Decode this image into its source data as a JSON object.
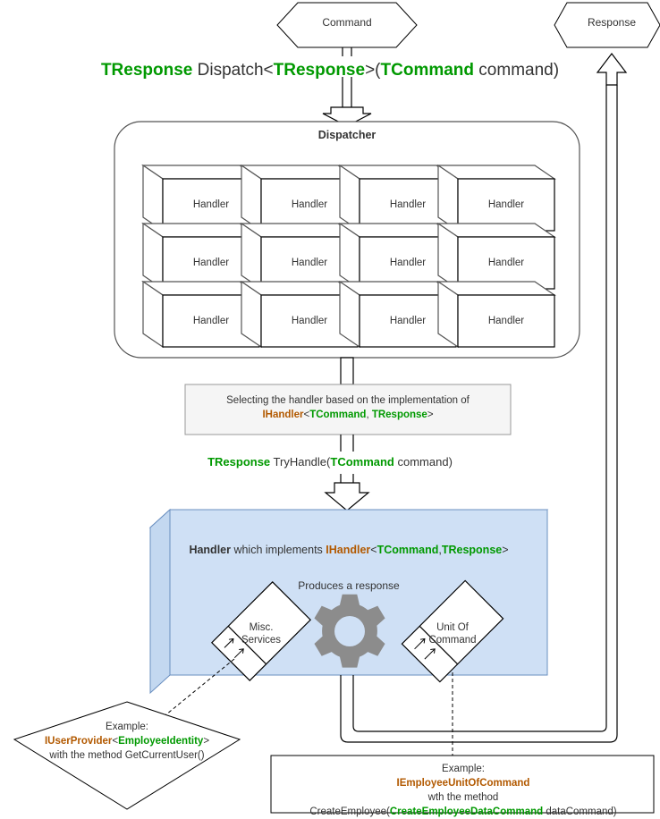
{
  "diagram": {
    "title": "CQRS Dispatcher / Handler flow",
    "colors": {
      "green": "#009900",
      "orange": "#b25900",
      "text": "#333333",
      "handler_box_fill": "#cfe0f5",
      "handler_box_top": "#dbe8f8",
      "handler_box_side": "#c3d8f0",
      "handler_box_stroke": "#6a8fc0",
      "note_fill": "#f5f5f5",
      "gear": "#8c8c8c",
      "shape_stroke": "#000000",
      "box3d_stroke": "#808080"
    },
    "nodes": {
      "command": {
        "label": "Command",
        "shape": "hexagon"
      },
      "response": {
        "label": "Response",
        "shape": "hexagon"
      },
      "dispatcher": {
        "label": "Dispatcher",
        "shape": "rounded-rect"
      }
    },
    "signature_dispatch": {
      "parts": [
        {
          "text": "TResponse",
          "color": "green"
        },
        {
          "text": " Dispatch<",
          "color": "text"
        },
        {
          "text": "TResponse",
          "color": "green"
        },
        {
          "text": ">(",
          "color": "text"
        },
        {
          "text": "TCommand",
          "color": "green"
        },
        {
          "text": " command)",
          "color": "text"
        }
      ]
    },
    "signature_tryhandle": {
      "parts": [
        {
          "text": "TResponse",
          "color": "green"
        },
        {
          "text": " TryHandle(",
          "color": "text"
        },
        {
          "text": "TCommand",
          "color": "green"
        },
        {
          "text": " command)",
          "color": "text"
        }
      ]
    },
    "handlers": {
      "label": "Handler",
      "rows": 3,
      "cols": 4,
      "cells": [
        "Handler",
        "Handler",
        "Handler",
        "Handler",
        "Handler",
        "Handler",
        "Handler",
        "Handler",
        "Handler",
        "Handler",
        "Handler",
        "Handler"
      ]
    },
    "note_selecting": {
      "line1": "Selecting the handler based on the implementation of",
      "line2_parts": [
        {
          "text": "IHandler",
          "color": "orange"
        },
        {
          "text": "<",
          "color": "text"
        },
        {
          "text": "TCommand",
          "color": "green"
        },
        {
          "text": ", ",
          "color": "text"
        },
        {
          "text": "TResponse",
          "color": "green"
        },
        {
          "text": ">",
          "color": "text"
        }
      ]
    },
    "handler_detail": {
      "title_parts": [
        {
          "text": "Handler",
          "color": "bold"
        },
        {
          "text": " which implements ",
          "color": "text"
        },
        {
          "text": "IHandler",
          "color": "orange"
        },
        {
          "text": "<",
          "color": "text"
        },
        {
          "text": "TCommand",
          "color": "green"
        },
        {
          "text": ",",
          "color": "text"
        },
        {
          "text": "TResponse",
          "color": "green"
        },
        {
          "text": ">",
          "color": "text"
        }
      ],
      "produces_label": "Produces a response",
      "misc_services_label": "Misc.\nServices",
      "misc_services_line1": "Misc.",
      "misc_services_line2": "Services",
      "unit_of_command_line1": "Unit Of",
      "unit_of_command_line2": "Command",
      "gear_icon": "gear-icon"
    },
    "example_left": {
      "line1": "Example:",
      "line2_parts": [
        {
          "text": "IUserProvider",
          "color": "orange"
        },
        {
          "text": "<",
          "color": "text"
        },
        {
          "text": "EmployeeIdentity",
          "color": "green"
        },
        {
          "text": ">",
          "color": "text"
        }
      ],
      "line3": "with the method GetCurrentUser()"
    },
    "example_right": {
      "line1": "Example:",
      "line2_parts": [
        {
          "text": "IEmployeeUnitOfCommand",
          "color": "orange"
        }
      ],
      "line3": "wth the method",
      "line4_parts": [
        {
          "text": "CreateEmployee(",
          "color": "text"
        },
        {
          "text": "CreateEmployeeDataCommand",
          "color": "green"
        },
        {
          "text": " dataCommand)",
          "color": "text"
        }
      ]
    }
  }
}
